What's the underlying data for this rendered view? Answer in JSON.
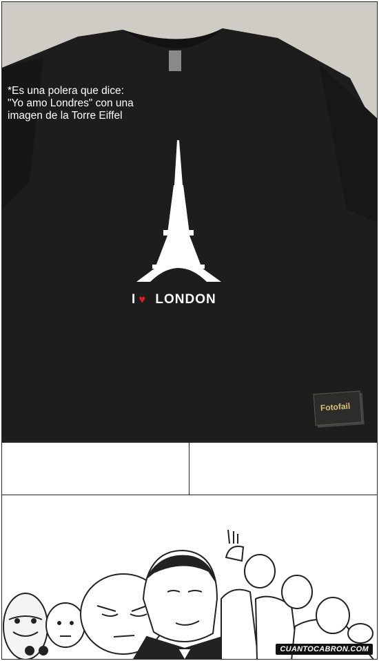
{
  "photo": {
    "caption": "*Es una polera que dice:\n\"Yo amo Londres\" con una\nimagen de la Torre Eiffel",
    "shirt_text_i": "I",
    "shirt_text_heart": "♥",
    "shirt_text_word": "LONDON",
    "watermark": "Fotofail"
  },
  "footer": {
    "site": "CUANTOCABRON.COM"
  },
  "colors": {
    "shirt": "#1c1c1c",
    "heart": "#d6202b",
    "background": "#d8d6d2"
  }
}
